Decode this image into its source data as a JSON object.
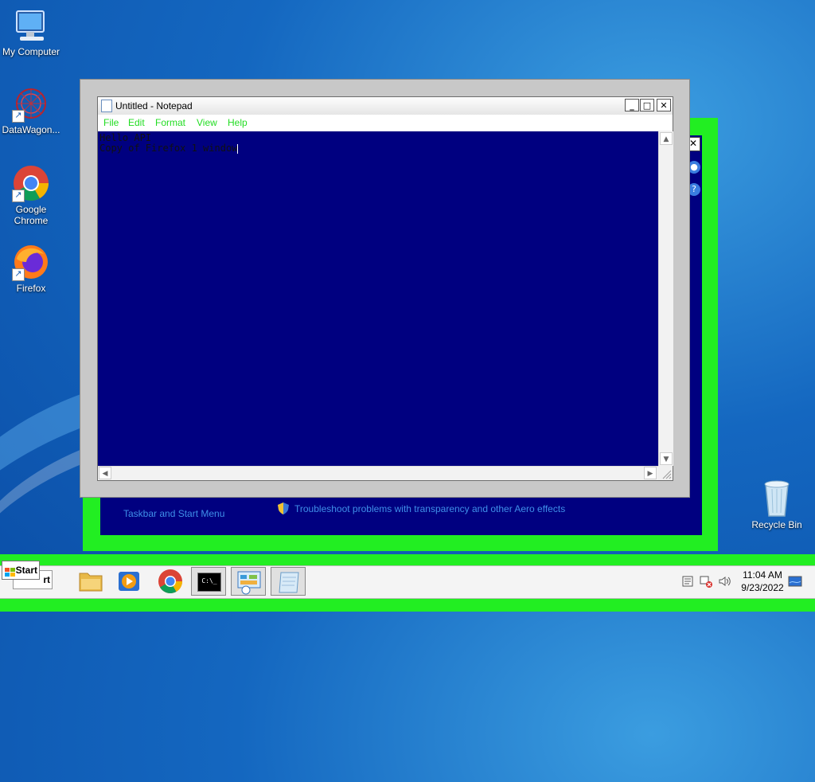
{
  "desktop": {
    "icons": [
      {
        "label": "My Computer",
        "icon": "computer-icon"
      },
      {
        "label": "DataWagon...",
        "icon": "datawagon-icon"
      },
      {
        "label": "Google Chrome",
        "icon": "chrome-icon"
      },
      {
        "label": "Firefox",
        "icon": "firefox-icon"
      }
    ],
    "recycle_bin": {
      "label": "Recycle Bin",
      "icon": "recycle-bin-icon"
    }
  },
  "back_window": {
    "link_taskbar": "Taskbar and Start Menu",
    "link_troubleshoot": "Troubleshoot problems with transparency and other Aero effects",
    "close_glyph": "✕",
    "help_glyph": "?"
  },
  "notepad": {
    "title": "Untitled - Notepad",
    "minimize": "_",
    "maximize": "□",
    "close": "✕",
    "menu": [
      "File",
      "Edit",
      "Format",
      "View",
      "Help"
    ],
    "text_line1": "Hello API",
    "text_line2": "Copy of Firefox 1 window"
  },
  "taskbar": {
    "start_label": "Start",
    "start_shadow_label": "rt",
    "apps": [
      {
        "name": "explorer",
        "icon": "folder-icon"
      },
      {
        "name": "media-player",
        "icon": "media-player-icon"
      },
      {
        "name": "chrome",
        "icon": "chrome-icon"
      },
      {
        "name": "cmd",
        "icon": "cmd-icon",
        "text": "C:\\_"
      },
      {
        "name": "control-panel",
        "icon": "control-panel-icon"
      },
      {
        "name": "notepad",
        "icon": "notepad-icon"
      }
    ],
    "clock_time": "11:04 AM",
    "clock_date": "9/23/2022"
  },
  "colors": {
    "accent_green": "#22ee22",
    "editor_bg": "#000080",
    "desktop_blue": "#1467c0"
  }
}
